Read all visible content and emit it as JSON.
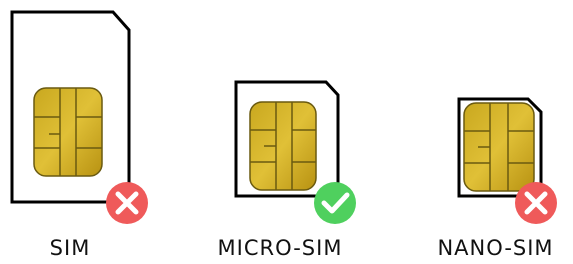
{
  "cards": [
    {
      "label": "SIM",
      "status": "invalid",
      "status_icon": "x-icon"
    },
    {
      "label": "MICRO-SIM",
      "status": "valid",
      "status_icon": "check-icon"
    },
    {
      "label": "NANO-SIM",
      "status": "invalid",
      "status_icon": "x-icon"
    }
  ],
  "colors": {
    "outline": "#000000",
    "chip_gold": "#d6b21e",
    "chip_line": "#6a5a10",
    "invalid": "#ef5a5a",
    "valid": "#4fd05e"
  }
}
